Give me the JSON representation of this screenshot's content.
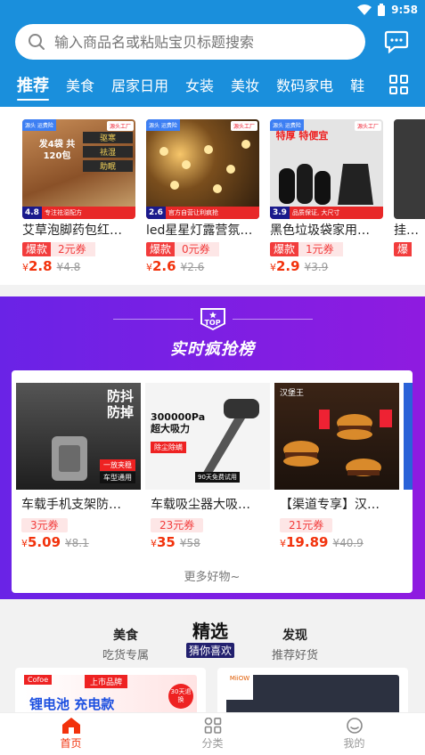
{
  "status": {
    "time": "9:58"
  },
  "search": {
    "placeholder": "输入商品名或粘贴宝贝标题搜索"
  },
  "tabs": [
    "推荐",
    "美食",
    "居家日用",
    "女装",
    "美妆",
    "数码家电",
    "鞋"
  ],
  "products": [
    {
      "title": "艾草泡脚药包红…",
      "badge": "爆款",
      "coupon": "2元券",
      "price": "2.8",
      "old_price": "4.8",
      "img_price": "4.8",
      "img_text": "专注祛湿配方",
      "img_headline": "驱寒 祛湿 助眠",
      "tag": "源头工厂",
      "pack": "发4袋 共120包",
      "bg": "#7a4a2a"
    },
    {
      "title": "led星星灯露营氛…",
      "badge": "爆款",
      "coupon": "0元券",
      "price": "2.6",
      "old_price": "2.6",
      "img_price": "2.6",
      "img_text": "官方自营让利疯抢",
      "tag": "源头工厂",
      "bg": "#3b2c1a"
    },
    {
      "title": "黑色垃圾袋家用…",
      "badge": "爆款",
      "coupon": "1元券",
      "price": "2.9",
      "old_price": "3.9",
      "img_price": "3.9",
      "img_text": "品质保证, 大尺寸",
      "img_headline": "特厚 特便宜",
      "tag": "源头工厂",
      "bg": "#dcdcdc"
    },
    {
      "title": "挂…",
      "badge": "爆",
      "price": "",
      "bg": "#444"
    }
  ],
  "ranking": {
    "top_label": "TOP",
    "title": "实时疯抢榜",
    "more": "更多好物~",
    "items": [
      {
        "title": "车载手机支架防…",
        "coupon": "3元券",
        "price": "5.09",
        "old_price": "8.1",
        "img_text1": "防抖",
        "img_text2": "防掉",
        "img_tag1": "一放夹稳",
        "img_tag2": "车型通用",
        "bg": "#2b2b2b"
      },
      {
        "title": "车载吸尘器大吸…",
        "coupon": "23元券",
        "price": "35",
        "old_price": "58",
        "img_text1": "300000Pa",
        "img_text2": "超大吸力",
        "img_tag1": "除尘除螨",
        "img_tag2": "90天免费试用",
        "bg": "#ececec"
      },
      {
        "title": "【渠道专享】汉…",
        "coupon": "21元券",
        "price": "19.89",
        "old_price": "40.9",
        "img_text1": "汉堡王",
        "bg": "#2a1a12"
      }
    ]
  },
  "choice": {
    "left": {
      "title": "美食",
      "sub": "吃货专属"
    },
    "center": {
      "title": "精选",
      "sub": "猜你喜欢"
    },
    "right": {
      "title": "发现",
      "sub": "推荐好货"
    },
    "card1_text": "锂电池 充电款",
    "card1_brand": "上市品牌",
    "card1_badge": "30天退换"
  },
  "nav": [
    {
      "label": "首页",
      "icon": "home-icon",
      "active": true
    },
    {
      "label": "分类",
      "icon": "category-icon",
      "active": false
    },
    {
      "label": "我的",
      "icon": "profile-icon",
      "active": false
    }
  ],
  "colors": {
    "primary": "#1a8fdc",
    "accent": "#f2320c",
    "rank_bg": "#7a1fe4"
  },
  "currency": "¥"
}
